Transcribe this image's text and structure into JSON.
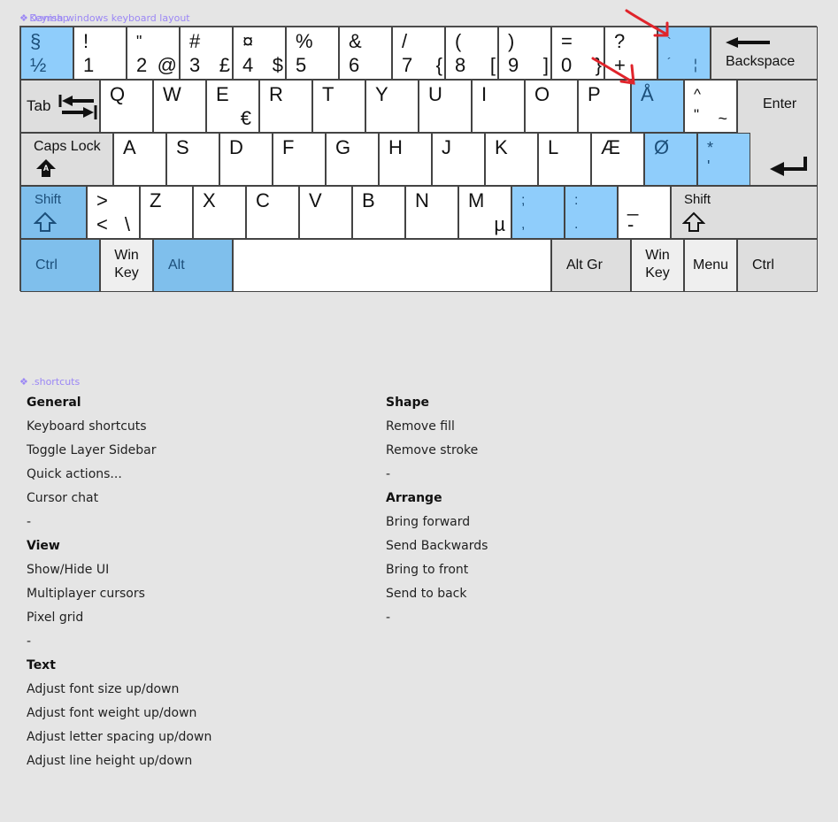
{
  "frames": {
    "keyboard_label": "Danish windows keyboard layout",
    "keyboard_label_overlap": "Keymap",
    "shortcuts_label": ".shortcuts",
    "component_icon": "component-icon"
  },
  "colors": {
    "highlight_key": "#8fcdfb",
    "modifier_key": "#7fbfec",
    "special_key": "#dedede",
    "annotation_arrow": "#e0242b",
    "frame_label": "#9b87f5"
  },
  "keyboard": {
    "row1": [
      {
        "top": "§",
        "bottom": "½"
      },
      {
        "top": "!",
        "bottom": "1"
      },
      {
        "top": "\"",
        "bottom": "2",
        "alt": "@"
      },
      {
        "top": "#",
        "bottom": "3",
        "alt": "£"
      },
      {
        "top": "¤",
        "bottom": "4",
        "alt": "$"
      },
      {
        "top": "%",
        "bottom": "5"
      },
      {
        "top": "&",
        "bottom": "6"
      },
      {
        "top": "/",
        "bottom": "7",
        "alt": "{"
      },
      {
        "top": "(",
        "bottom": "8",
        "alt": "["
      },
      {
        "top": ")",
        "bottom": "9",
        "alt": "]"
      },
      {
        "top": "=",
        "bottom": "0",
        "alt": "}"
      },
      {
        "top": "?",
        "bottom": "+"
      },
      {
        "top": "`",
        "bottom": "´",
        "alt": "¦"
      }
    ],
    "backspace": "Backspace",
    "tab": "Tab",
    "row2": [
      {
        "top": "Q"
      },
      {
        "top": "W"
      },
      {
        "top": "E",
        "alt": "€"
      },
      {
        "top": "R"
      },
      {
        "top": "T"
      },
      {
        "top": "Y"
      },
      {
        "top": "U"
      },
      {
        "top": "I"
      },
      {
        "top": "O"
      },
      {
        "top": "P"
      },
      {
        "top": "Å"
      },
      {
        "top": "^",
        "bottom": "\"",
        "alt": "~"
      }
    ],
    "enter": "Enter",
    "caps_lock": "Caps Lock",
    "row3": [
      {
        "top": "A"
      },
      {
        "top": "S"
      },
      {
        "top": "D"
      },
      {
        "top": "F"
      },
      {
        "top": "G"
      },
      {
        "top": "H"
      },
      {
        "top": "J"
      },
      {
        "top": "K"
      },
      {
        "top": "L"
      },
      {
        "top": "Æ"
      },
      {
        "top": "Ø"
      },
      {
        "top": "*",
        "bottom": "'"
      }
    ],
    "shift_left": "Shift",
    "row4": [
      {
        "top": ">",
        "bottom": "<",
        "alt": "\\"
      },
      {
        "top": "Z"
      },
      {
        "top": "X"
      },
      {
        "top": "C"
      },
      {
        "top": "V"
      },
      {
        "top": "B"
      },
      {
        "top": "N"
      },
      {
        "top": "M",
        "alt": "µ"
      },
      {
        "top": ";",
        "bottom": ","
      },
      {
        "top": ":",
        "bottom": "."
      },
      {
        "top": "_",
        "bottom": "-"
      }
    ],
    "shift_right": "Shift",
    "row5": {
      "ctrl_left": "Ctrl",
      "win_left_1": "Win",
      "win_left_2": "Key",
      "alt": "Alt",
      "space": "",
      "alt_gr": "Alt Gr",
      "win_right_1": "Win",
      "win_right_2": "Key",
      "menu": "Menu",
      "ctrl_right": "Ctrl"
    }
  },
  "shortcuts": {
    "left": [
      {
        "text": "General",
        "head": true
      },
      {
        "text": "Keyboard shortcuts"
      },
      {
        "text": "Toggle Layer Sidebar"
      },
      {
        "text": "Quick actions..."
      },
      {
        "text": "Cursor chat"
      },
      {
        "text": "-"
      },
      {
        "text": "View",
        "head": true
      },
      {
        "text": "Show/Hide UI"
      },
      {
        "text": "Multiplayer cursors"
      },
      {
        "text": "Pixel grid"
      },
      {
        "text": "-"
      },
      {
        "text": "Text",
        "head": true
      },
      {
        "text": "Adjust font size up/down"
      },
      {
        "text": "Adjust font weight up/down"
      },
      {
        "text": "Adjust letter spacing up/down"
      },
      {
        "text": "Adjust line height up/down"
      }
    ],
    "right": [
      {
        "text": "Shape",
        "head": true
      },
      {
        "text": "Remove fill"
      },
      {
        "text": "Remove stroke"
      },
      {
        "text": "-"
      },
      {
        "text": "Arrange",
        "head": true
      },
      {
        "text": "Bring forward"
      },
      {
        "text": "Send Backwards"
      },
      {
        "text": "Bring to front"
      },
      {
        "text": "Send to back"
      },
      {
        "text": "-"
      }
    ]
  }
}
